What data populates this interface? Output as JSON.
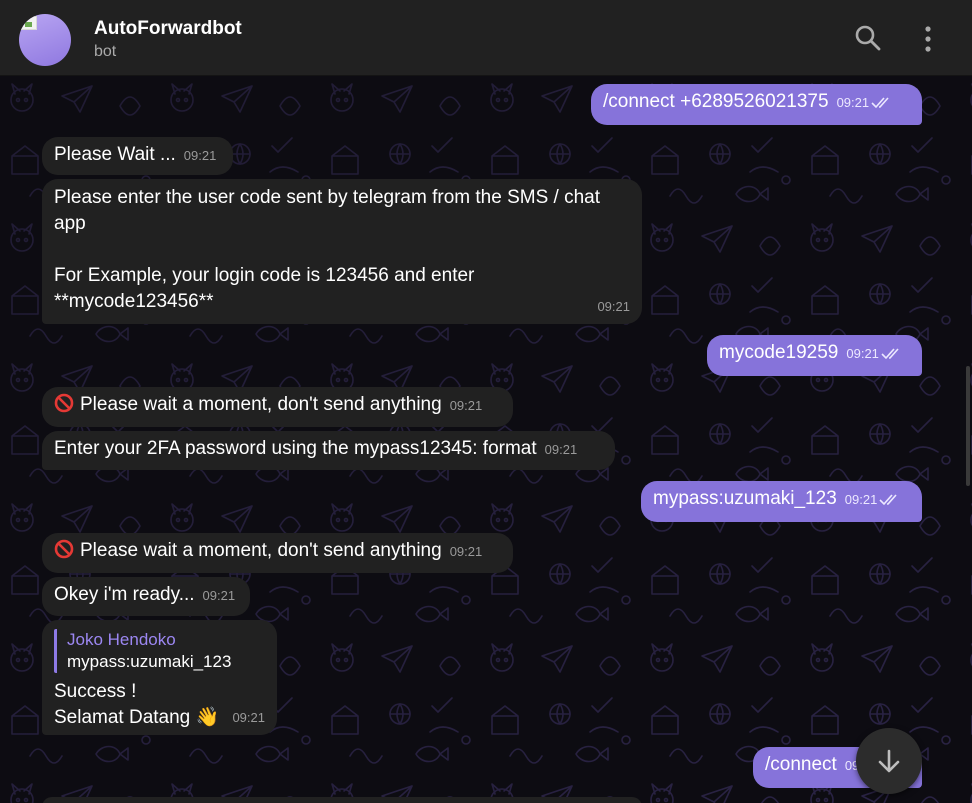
{
  "header": {
    "title": "AutoForwardbot",
    "subtitle": "bot"
  },
  "colors": {
    "outgoing": "#8673da",
    "incoming": "#212121",
    "reply_accent": "#9c87f2"
  },
  "messages": [
    {
      "dir": "out",
      "text": "/connect +6289526021375",
      "time": "09:21"
    },
    {
      "dir": "in",
      "text": "Please Wait ...",
      "time": "09:21"
    },
    {
      "dir": "in",
      "lines": [
        "Please enter the user code sent by telegram from the SMS / chat",
        "app",
        "",
        "For Example, your login code is 123456 and enter",
        "**mycode123456**"
      ],
      "time": "09:21"
    },
    {
      "dir": "out",
      "text": "mycode19259",
      "time": "09:21"
    },
    {
      "dir": "in",
      "icon": "no-entry-icon",
      "text": "Please wait a moment, don't send anything",
      "time": "09:21"
    },
    {
      "dir": "in",
      "text": "Enter your 2FA password using the mypass12345: format",
      "time": "09:21"
    },
    {
      "dir": "out",
      "text": "mypass:uzumaki_123",
      "time": "09:21"
    },
    {
      "dir": "in",
      "icon": "no-entry-icon",
      "text": "Please wait a moment, don't send anything",
      "time": "09:21"
    },
    {
      "dir": "in",
      "text": "Okey i'm ready...",
      "time": "09:21"
    },
    {
      "dir": "in",
      "reply": {
        "name": "Joko Hendoko",
        "text": "mypass:uzumaki_123"
      },
      "lines": [
        "Success !",
        "Selamat Datang 👋"
      ],
      "time": "09:21"
    },
    {
      "dir": "out",
      "text": "/connect",
      "time": "09:21"
    }
  ]
}
